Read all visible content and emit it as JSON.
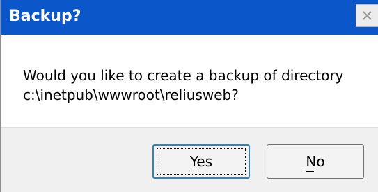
{
  "dialog": {
    "title": "Backup?",
    "message_line1": "Would you like to create a backup of directory",
    "message_line2": "c:\\inetpub\\wwwroot\\reliusweb?",
    "close_icon": "close-icon"
  },
  "buttons": {
    "yes_label": "Yes",
    "no_label": "No"
  },
  "colors": {
    "titlebar": "#0b57c9",
    "button_area": "#f0f0f0"
  }
}
